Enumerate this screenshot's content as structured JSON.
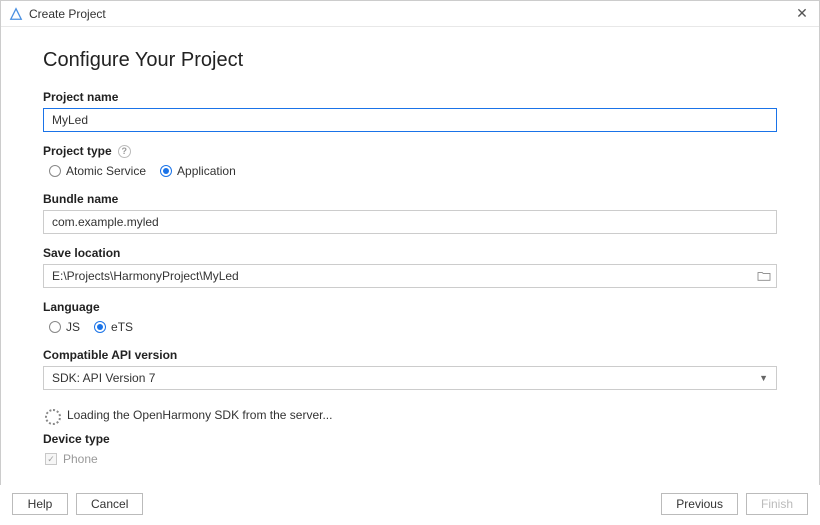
{
  "window": {
    "title": "Create Project"
  },
  "heading": "Configure Your Project",
  "fields": {
    "project_name": {
      "label": "Project name",
      "value": "MyLed"
    },
    "project_type": {
      "label": "Project type",
      "options": {
        "atomic": "Atomic Service",
        "application": "Application"
      },
      "selected": "application"
    },
    "bundle_name": {
      "label": "Bundle name",
      "value": "com.example.myled"
    },
    "save_location": {
      "label": "Save location",
      "value": "E:\\Projects\\HarmonyProject\\MyLed"
    },
    "language": {
      "label": "Language",
      "options": {
        "js": "JS",
        "ets": "eTS"
      },
      "selected": "ets"
    },
    "api_version": {
      "label": "Compatible API version",
      "value": "SDK: API Version 7"
    },
    "loading_text": "Loading the OpenHarmony SDK from the server...",
    "device_type": {
      "label": "Device type",
      "phone": "Phone",
      "phone_checked": true,
      "phone_disabled": true
    }
  },
  "buttons": {
    "help": "Help",
    "cancel": "Cancel",
    "previous": "Previous",
    "finish": "Finish"
  }
}
